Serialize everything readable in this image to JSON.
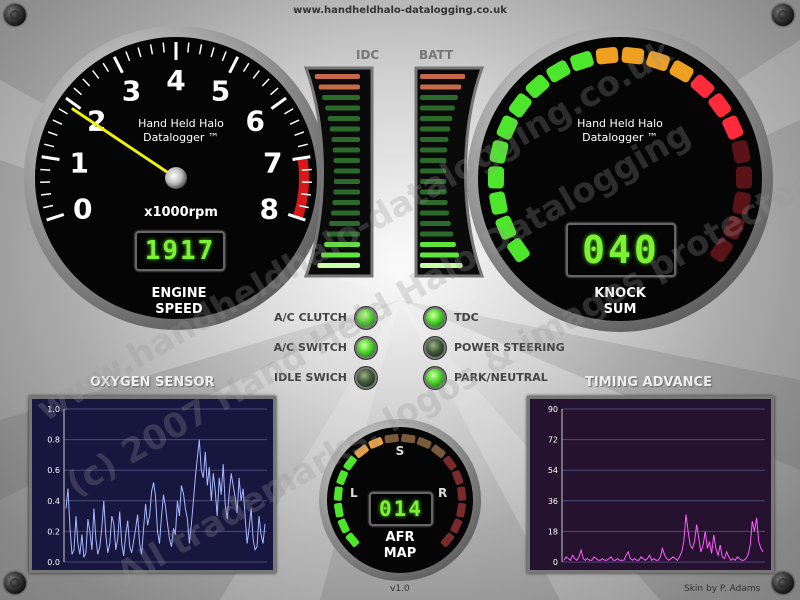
{
  "header": {
    "site_url": "www.handheldhalo-datalogging.co.uk"
  },
  "footer": {
    "version": "v1.0",
    "credit": "Skin by P. Adams"
  },
  "watermark": {
    "lines": [
      "www.handheldhalo-datalogging.co.uk",
      "(c) 2007 Hand Held Halo Datalogging",
      "All trademarks, logos & images protected"
    ]
  },
  "engine_speed": {
    "brand_line1": "Hand Held Halo",
    "brand_line2": "Datalogger ™",
    "unit": "x1000rpm",
    "digital": "1917",
    "rpm_x1000": 1.917,
    "scale_labels": [
      "0",
      "1",
      "2",
      "3",
      "4",
      "5",
      "6",
      "7",
      "8"
    ],
    "label_line1": "ENGINE",
    "label_line2": "SPEED",
    "needle_color": "#f0f010",
    "redline_color": "#d81818"
  },
  "bars": {
    "idc_label": "IDC",
    "batt_label": "BATT",
    "idc_lit_fraction": 0.15,
    "batt_lit_fraction": 0.15
  },
  "knock": {
    "brand_line1": "Hand Held Halo",
    "brand_line2": "Datalogger ™",
    "digital": "040",
    "label_line1": "KNOCK",
    "label_line2": "SUM",
    "segments_lit": 17
  },
  "lamps": {
    "left": [
      {
        "label": "A/C CLUTCH",
        "on": true
      },
      {
        "label": "A/C SWITCH",
        "on": true
      },
      {
        "label": "IDLE SWICH",
        "on": false
      }
    ],
    "right": [
      {
        "label": "TDC",
        "on": true
      },
      {
        "label": "POWER STEERING",
        "on": false
      },
      {
        "label": "PARK/NEUTRAL",
        "on": true
      }
    ]
  },
  "afr": {
    "s_label": "S",
    "l_label": "L",
    "r_label": "R",
    "digital": "014",
    "label_line1": "AFR",
    "label_line2": "MAP",
    "segments_lit": 8
  },
  "oxygen": {
    "title": "OXYGEN SENSOR",
    "line_color": "#a8b8ff",
    "bg_color": "#16163f",
    "chart_data": {
      "type": "line",
      "ylim": [
        0,
        1.0
      ],
      "yticks": [
        "1.0",
        "0.8",
        "0.6",
        "0.4",
        "0.2",
        "0.0"
      ],
      "values": [
        0.35,
        0.48,
        0.22,
        0.05,
        0.08,
        0.3,
        0.12,
        0.05,
        0.18,
        0.03,
        0.06,
        0.28,
        0.2,
        0.08,
        0.35,
        0.15,
        0.05,
        0.1,
        0.22,
        0.4,
        0.18,
        0.06,
        0.12,
        0.3,
        0.25,
        0.08,
        0.15,
        0.33,
        0.12,
        0.04,
        0.18,
        0.27,
        0.1,
        0.06,
        0.14,
        0.22,
        0.31,
        0.12,
        0.05,
        0.22,
        0.38,
        0.24,
        0.3,
        0.46,
        0.52,
        0.43,
        0.2,
        0.12,
        0.3,
        0.44,
        0.36,
        0.25,
        0.15,
        0.1,
        0.22,
        0.18,
        0.4,
        0.3,
        0.5,
        0.45,
        0.35,
        0.28,
        0.12,
        0.25,
        0.4,
        0.55,
        0.68,
        0.8,
        0.6,
        0.55,
        0.72,
        0.5,
        0.62,
        0.4,
        0.58,
        0.46,
        0.3,
        0.55,
        0.44,
        0.64,
        0.38,
        0.28,
        0.45,
        0.58,
        0.5,
        0.42,
        0.32,
        0.55,
        0.4,
        0.48,
        0.3,
        0.12,
        0.22,
        0.35,
        0.15,
        0.08,
        0.1,
        0.3,
        0.18,
        0.12,
        0.25
      ]
    }
  },
  "timing": {
    "title": "TIMING ADVANCE",
    "line_color": "#ff5cff",
    "bg_color": "#25122e",
    "chart_data": {
      "type": "line",
      "ylim": [
        0,
        90
      ],
      "yticks": [
        "90",
        "72",
        "54",
        "36",
        "18",
        "0"
      ],
      "values": [
        1,
        3,
        2,
        1,
        4,
        2,
        1,
        3,
        7,
        2,
        1,
        2,
        1,
        1,
        3,
        2,
        1,
        1,
        2,
        1,
        1,
        2,
        3,
        1,
        1,
        2,
        1,
        1,
        1,
        4,
        6,
        2,
        1,
        2,
        1,
        1,
        3,
        2,
        1,
        2,
        4,
        1,
        2,
        1,
        1,
        3,
        8,
        4,
        2,
        1,
        2,
        3,
        2,
        1,
        3,
        6,
        12,
        28,
        18,
        10,
        8,
        12,
        22,
        14,
        6,
        10,
        18,
        8,
        12,
        5,
        16,
        8,
        4,
        10,
        3,
        2,
        6,
        3,
        1,
        2,
        1,
        3,
        2,
        1,
        1,
        2,
        4,
        10,
        24,
        18,
        26,
        12,
        8,
        6
      ]
    }
  }
}
